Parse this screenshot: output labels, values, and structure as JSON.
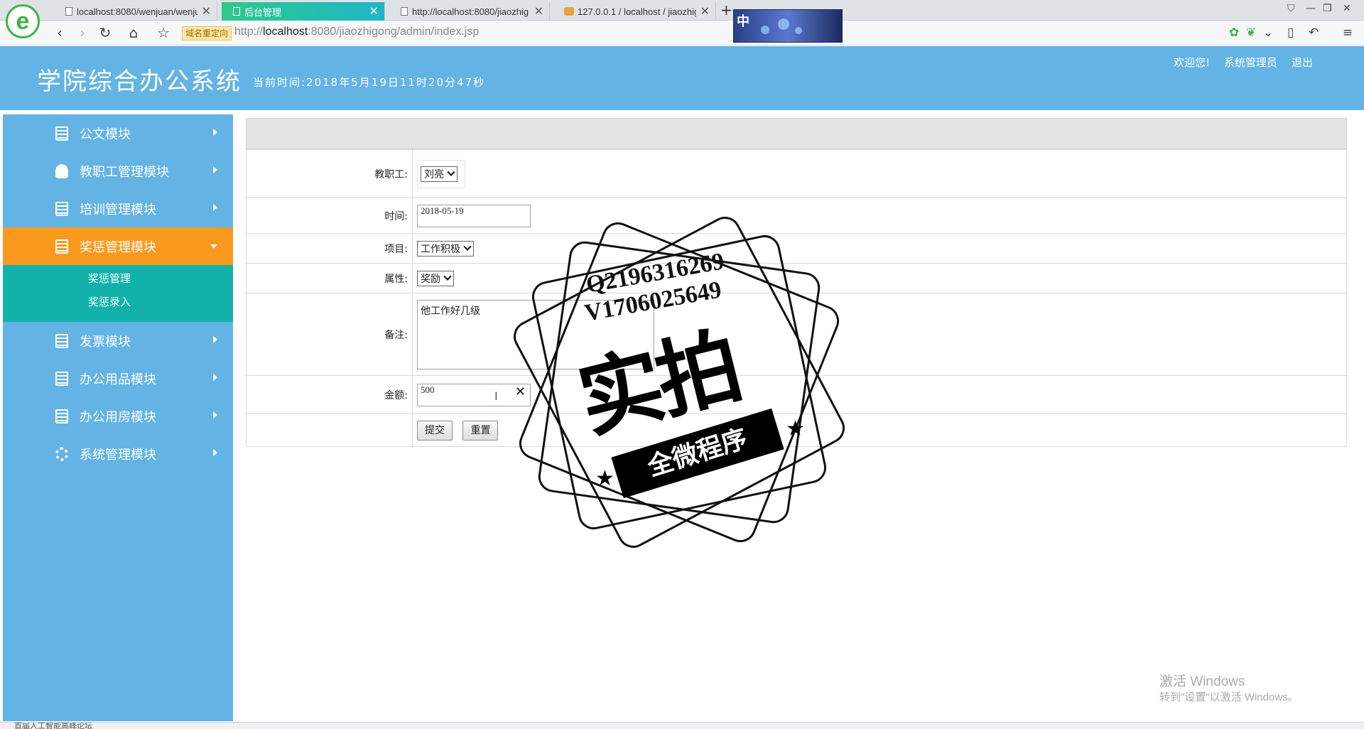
{
  "browser": {
    "tabs": [
      {
        "title": "localhost:8080/wenjuan/wenju",
        "active": false
      },
      {
        "title": "后台管理",
        "active": true
      },
      {
        "title": "http://localhost:8080/jiaozhig",
        "active": false
      },
      {
        "title": "127.0.0.1 / localhost / jiaozhig",
        "active": false
      }
    ],
    "new_tab_label": "+",
    "redirect_badge": "域名重定向",
    "url_prefix": "http://",
    "url_host": "localhost",
    "url_rest": ":8080/jiaozhigong/admin/index.jsp",
    "ime_label": "中"
  },
  "header": {
    "title": "学院综合办公系统",
    "current_time": "当前时间:2018年5月19日11时20分47秒",
    "welcome": "欢迎您!",
    "user": "系统管理员",
    "logout": "退出"
  },
  "sidebar": {
    "items": [
      {
        "label": "公文模块",
        "icon": "book-icon"
      },
      {
        "label": "教职工管理模块",
        "icon": "user-icon"
      },
      {
        "label": "培训管理模块",
        "icon": "book-icon"
      },
      {
        "label": "奖惩管理模块",
        "icon": "book-icon",
        "active": true
      },
      {
        "label": "发票模块",
        "icon": "book-icon"
      },
      {
        "label": "办公用品模块",
        "icon": "book-icon"
      },
      {
        "label": "办公用房模块",
        "icon": "book-icon"
      },
      {
        "label": "系统管理模块",
        "icon": "gear-icon"
      }
    ],
    "submenu": [
      "奖惩管理",
      "奖惩录入"
    ]
  },
  "form": {
    "employee_label": "教职工:",
    "employee_value": "刘亮",
    "date_label": "时间:",
    "date_value": "2018-05-19",
    "item_label": "项目:",
    "item_value": "工作积极",
    "attr_label": "属性:",
    "attr_value": "奖励",
    "note_label": "备注:",
    "note_value": "他工作好几级",
    "amount_label": "金额:",
    "amount_value": "500",
    "submit_label": "提交",
    "reset_label": "重置"
  },
  "watermark": {
    "line1": "Q2196316269",
    "line2": "V1706025649",
    "big": "实拍",
    "ribbon": "全微程序"
  },
  "windows": {
    "activate_title": "激活 Windows",
    "activate_sub": "转到\"设置\"以激活 Windows。"
  },
  "status_text": "首届人工智能高峰论坛"
}
